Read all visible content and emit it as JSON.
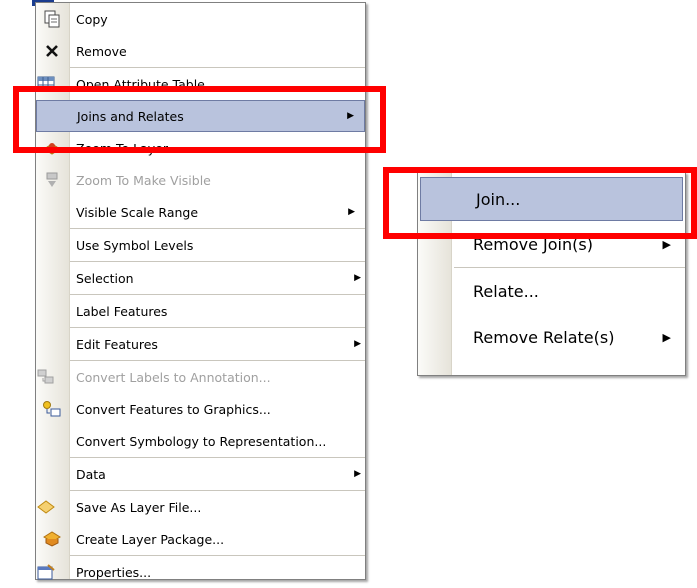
{
  "context_menu": {
    "items": [
      {
        "label": "Copy",
        "icon": "copy-icon"
      },
      {
        "label": "Remove",
        "icon": "remove-icon"
      },
      {
        "label": "Open Attribute Table",
        "icon": "table-icon"
      },
      {
        "label": "Joins and Relates",
        "icon": "none",
        "submenu": true,
        "highlighted": true
      },
      {
        "label": "Zoom To Layer",
        "icon": "zoom-layer-icon"
      },
      {
        "label": "Zoom To Make Visible",
        "icon": "zoom-visible-icon",
        "disabled": true
      },
      {
        "label": "Visible Scale Range",
        "submenu": true
      },
      {
        "label": "Use Symbol Levels"
      },
      {
        "label": "Selection",
        "submenu": true
      },
      {
        "label": "Label Features"
      },
      {
        "label": "Edit Features",
        "submenu": true
      },
      {
        "label": "Convert Labels to Annotation...",
        "icon": "convert-labels-icon",
        "disabled": true
      },
      {
        "label": "Convert Features to Graphics...",
        "icon": "convert-features-icon"
      },
      {
        "label": "Convert Symbology to Representation..."
      },
      {
        "label": "Data",
        "submenu": true
      },
      {
        "label": "Save As Layer File...",
        "icon": "layer-file-icon"
      },
      {
        "label": "Create Layer Package...",
        "icon": "layer-package-icon"
      },
      {
        "label": "Properties...",
        "icon": "properties-icon"
      }
    ]
  },
  "submenu": {
    "items": [
      {
        "label": "Join...",
        "highlighted": true
      },
      {
        "label": "Remove Join(s)",
        "submenu": true
      },
      {
        "label": "Relate..."
      },
      {
        "label": "Remove Relate(s)",
        "submenu": true
      }
    ]
  },
  "arrow_glyph": "▶",
  "colors": {
    "highlight": "#b9c3dd",
    "highlight_border": "#6e7ba3",
    "annotation": "#ff0000"
  }
}
